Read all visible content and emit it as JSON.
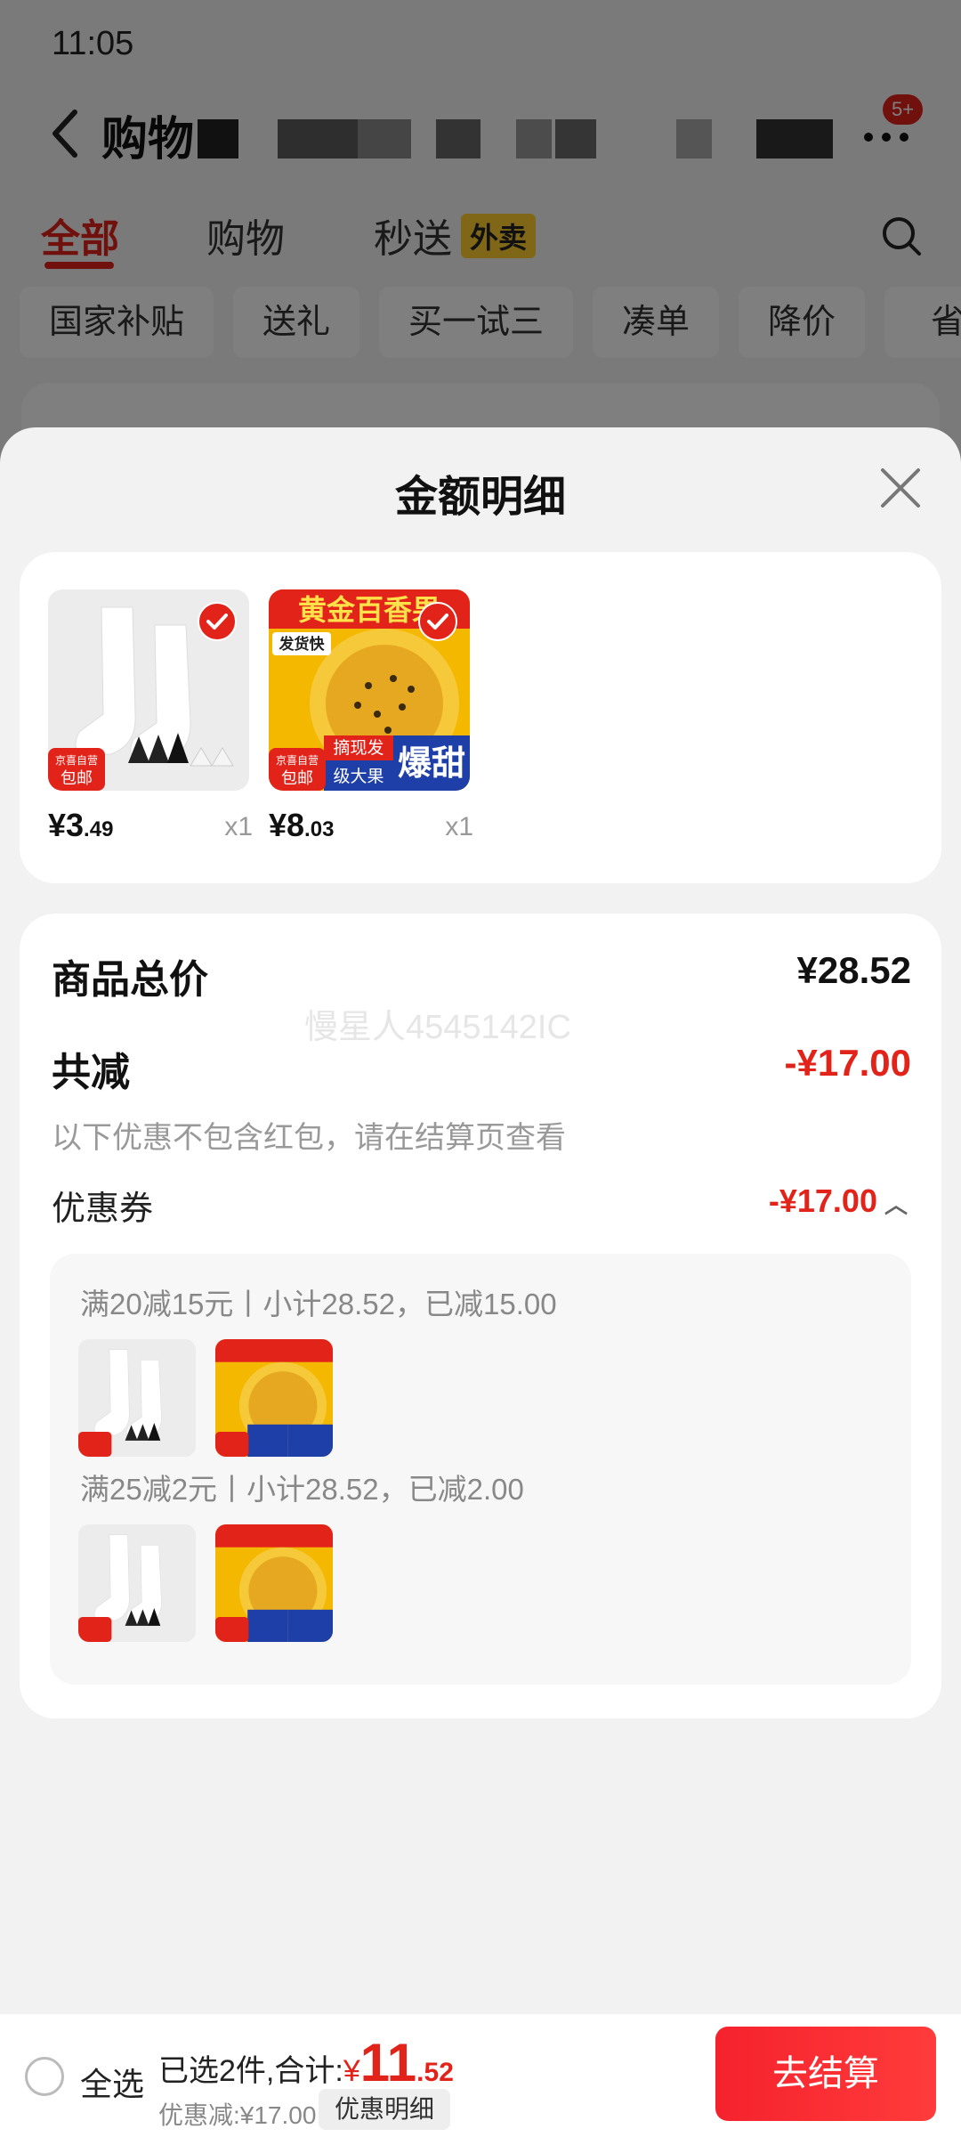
{
  "status_bar": {
    "time": "11:05"
  },
  "cart_header": {
    "title": "购物",
    "message_badge": "5+"
  },
  "tabs": [
    {
      "label": "全部",
      "active": true
    },
    {
      "label": "购物",
      "active": false
    },
    {
      "label": "秒送",
      "active": false,
      "tag": "外卖"
    }
  ],
  "chips": [
    "国家补贴",
    "送礼",
    "买一试三",
    "凑单",
    "降价",
    "省"
  ],
  "sheet": {
    "title": "金额明细",
    "products": [
      {
        "name": "socks",
        "price_int": "¥3",
        "price_dec": ".49",
        "qty": "x1",
        "tag_top": "京喜自营",
        "tag_bottom": "包邮"
      },
      {
        "name": "passion-fruit",
        "price_int": "¥8",
        "price_dec": ".03",
        "qty": "x1",
        "tag_top": "京喜自营",
        "tag_bottom": "包邮",
        "banner": "黄金百香果",
        "badge": "发货快",
        "label1": "摘现发",
        "label2": "级大果",
        "label3": "爆甜"
      }
    ],
    "total_label": "商品总价",
    "total_value": "¥28.52",
    "watermark": "慢星人4545142IC",
    "reduce_label": "共减",
    "reduce_value": "-¥17.00",
    "reduce_note": "以下优惠不包含红包，请在结算页查看",
    "coupon_label": "优惠券",
    "coupon_value": "-¥17.00",
    "coupon_rules": [
      "满20减15元丨小计28.52，已减15.00",
      "满25减2元丨小计28.52，已减2.00"
    ]
  },
  "bottom_bar": {
    "select_all": "全选",
    "summary_prefix": "已选2件,合计:",
    "summary_yen": "¥",
    "summary_int": "11",
    "summary_frac": ".52",
    "discount_text": "优惠减:¥17.00",
    "detail_button": "优惠明细",
    "checkout_button": "去结算"
  },
  "colors": {
    "accent": "#e2231a",
    "checkout": "#f5222d",
    "takeout_tag": "#ffcf2e"
  }
}
